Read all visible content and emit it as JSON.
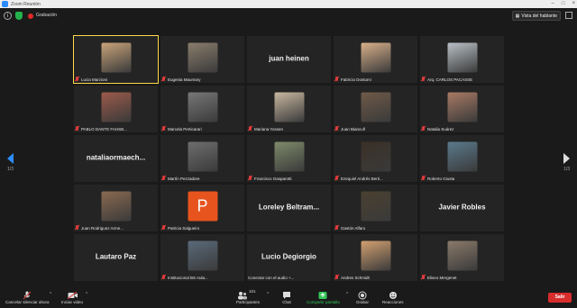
{
  "window": {
    "title": "Zoom Reunión"
  },
  "topbar": {
    "recording_label": "Grabación",
    "speaker_view_label": "Vista del hablante"
  },
  "pagination": {
    "left": "1/3",
    "right": "1/3"
  },
  "colors": {
    "accent": "#2d8cff",
    "leave": "#d82d2d",
    "share_green": "#35c759",
    "active_border": "#ffd84a"
  },
  "participants": [
    {
      "name": "Lucia Marzioni",
      "type": "photo",
      "photo_color": "#c9a37a"
    },
    {
      "name": "Eugenia Maumary",
      "type": "photo",
      "photo_color": "#8a7d6c"
    },
    {
      "name": "",
      "type": "text",
      "display_name": "juan heinen"
    },
    {
      "name": "Fabricio Dostumi",
      "type": "photo",
      "photo_color": "#d8b08a"
    },
    {
      "name": "Arq. CARLOS PACASSE",
      "type": "photo",
      "photo_color": "#b9c0c6"
    },
    {
      "name": "PABLO DANTE FAHSB...",
      "type": "photo",
      "photo_color": "#9c5a4a"
    },
    {
      "name": "Marcela Perticarari",
      "type": "photo",
      "photo_color": "#777777"
    },
    {
      "name": "Mariana Yossen",
      "type": "photo",
      "photo_color": "#c8b7a0"
    },
    {
      "name": "Juan Biancuñ",
      "type": "photo",
      "photo_color": "#6f5a48"
    },
    {
      "name": "Natalia Suárez",
      "type": "photo",
      "photo_color": "#a87a64"
    },
    {
      "name": "",
      "type": "text",
      "display_name": "nataliaormaech..."
    },
    {
      "name": "Martín Pezzadore",
      "type": "photo",
      "photo_color": "#6e6e6e"
    },
    {
      "name": "Francisco Gasparotti",
      "type": "photo",
      "photo_color": "#7e8a6a"
    },
    {
      "name": "Ezequiel Andrés Berti...",
      "type": "photo",
      "photo_color": "#3a3026"
    },
    {
      "name": "Roberto Giusta",
      "type": "photo",
      "photo_color": "#5a7a8c"
    },
    {
      "name": "Juan Rodriguez Arme...",
      "type": "photo",
      "photo_color": "#8a6a50"
    },
    {
      "name": "Patricia Salgueiro",
      "type": "initial",
      "initial": "P",
      "photo_color": "#e8541e"
    },
    {
      "name": "",
      "type": "text",
      "display_name": "Loreley Beltram..."
    },
    {
      "name": "Gastón Alfaro",
      "type": "photo",
      "photo_color": "#4a4030"
    },
    {
      "name": "",
      "type": "text",
      "display_name": "Javier Robles"
    },
    {
      "name": "",
      "type": "text",
      "display_name": "Lautaro Paz"
    },
    {
      "name": "Institucional BS Aula...",
      "type": "photo",
      "photo_color": "#5a6a7a"
    },
    {
      "name": "Conectar con el audio +...",
      "type": "text",
      "display_name": "Lucio Degiorgio",
      "no_mic": true
    },
    {
      "name": "Andres Schmidt",
      "type": "photo",
      "photo_color": "#d2a070"
    },
    {
      "name": "Eliseo Mergenet",
      "type": "photo",
      "photo_color": "#8a7a6a"
    }
  ],
  "toolbar": {
    "unmute": "Cancelar silenciar ahora",
    "video": "Iniciar video",
    "participants": "Participantes",
    "participants_count": "101",
    "chat": "Chat",
    "share": "Compartir pantalla",
    "record": "Grabar",
    "reactions": "Reacciones",
    "leave": "Salir"
  }
}
